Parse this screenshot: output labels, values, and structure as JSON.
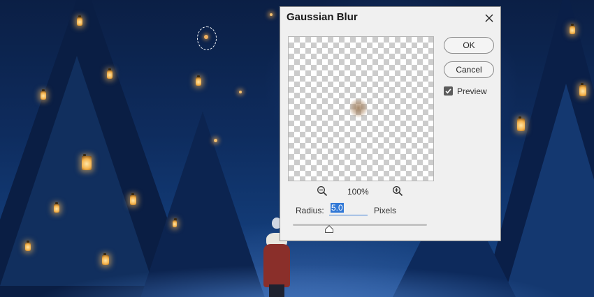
{
  "dialog": {
    "title": "Gaussian Blur",
    "buttons": {
      "ok": "OK",
      "cancel": "Cancel"
    },
    "preview": {
      "label": "Preview",
      "checked": true
    },
    "zoom": {
      "level": "100%"
    },
    "radius": {
      "label": "Radius:",
      "value": "5.0",
      "unit": "Pixels",
      "slider_fraction": 0.27
    }
  },
  "icons": {
    "close": "close-icon",
    "zoom_out": "zoom-out-icon",
    "zoom_in": "zoom-in-icon",
    "checkbox": "checkmark-icon",
    "slider": "slider-thumb-icon"
  },
  "colors": {
    "dialog_bg": "#f0f0f0",
    "input_accent": "#3178d6",
    "scene_sky": "#0e2c5e",
    "lantern_glow": "#f4b24c"
  }
}
